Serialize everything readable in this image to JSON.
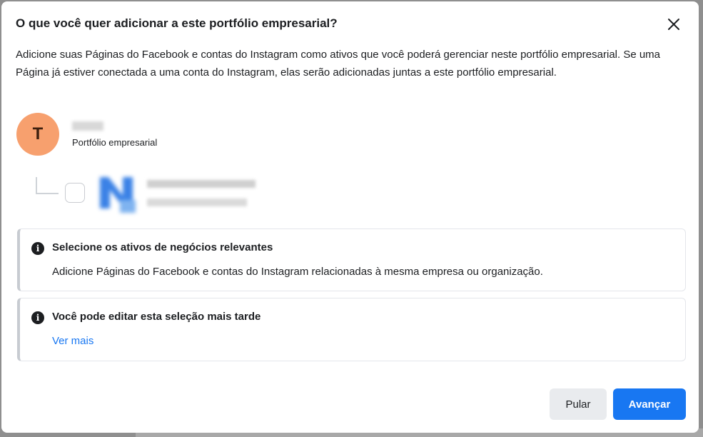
{
  "dialog": {
    "title": "O que você quer adicionar a este portfólio empresarial?",
    "intro": "Adicione suas Páginas do Facebook e contas do Instagram como ativos que você poderá gerenciar neste portfólio empresarial. Se uma Página já estiver conectada a uma conta do Instagram, elas serão adicionadas juntas a este portfólio empresarial.",
    "close_icon": "close-icon"
  },
  "portfolio": {
    "avatar_letter": "T",
    "avatar_color": "#f7a06e",
    "subtitle": "Portfólio empresarial"
  },
  "asset_item": {
    "checked": false
  },
  "info_boxes": [
    {
      "icon": "info-icon",
      "title": "Selecione os ativos de negócios relevantes",
      "body": "Adicione Páginas do Facebook e contas do Instagram relacionadas à mesma empresa ou organização."
    },
    {
      "icon": "info-icon",
      "title": "Você pode editar esta seleção mais tarde",
      "link": "Ver mais"
    }
  ],
  "buttons": {
    "skip": "Pular",
    "next": "Avançar"
  },
  "colors": {
    "primary": "#1877f2",
    "secondary_button": "#e9ebee",
    "text": "#1c1e21"
  }
}
